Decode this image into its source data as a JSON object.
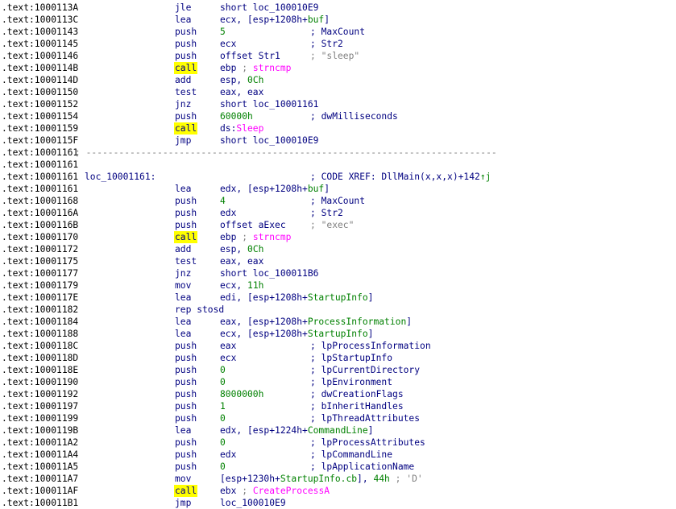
{
  "lines": [
    {
      "addr": ".text:1000113A",
      "mn": "jle",
      "ops": [
        [
          "short loc_100010E9",
          "kw"
        ]
      ]
    },
    {
      "addr": ".text:1000113C",
      "mn": "lea",
      "ops": [
        [
          "ecx, [esp+1208h+",
          "kw"
        ],
        [
          "buf",
          "var"
        ],
        [
          "]",
          "kw"
        ]
      ]
    },
    {
      "addr": ".text:10001143",
      "mn": "push",
      "ops": [
        [
          "5",
          "num"
        ]
      ],
      "cmt": [
        [
          "; MaxCount",
          "cmt"
        ]
      ]
    },
    {
      "addr": ".text:10001145",
      "mn": "push",
      "ops": [
        [
          "ecx",
          "kw"
        ]
      ],
      "cmt": [
        [
          "; Str2",
          "cmt"
        ]
      ]
    },
    {
      "addr": ".text:10001146",
      "mn": "push",
      "ops": [
        [
          "offset Str1",
          "kw"
        ]
      ],
      "cmt": [
        [
          "; \"sleep\"",
          "str"
        ]
      ]
    },
    {
      "addr": ".text:1000114B",
      "mn": "call",
      "hl": true,
      "ops": [
        [
          "ebp ",
          "kw"
        ],
        [
          "; ",
          "str"
        ],
        [
          "strncmp",
          "sym"
        ]
      ]
    },
    {
      "addr": ".text:1000114D",
      "mn": "add",
      "ops": [
        [
          "esp, ",
          "kw"
        ],
        [
          "0Ch",
          "num"
        ]
      ]
    },
    {
      "addr": ".text:10001150",
      "mn": "test",
      "ops": [
        [
          "eax, eax",
          "kw"
        ]
      ]
    },
    {
      "addr": ".text:10001152",
      "mn": "jnz",
      "ops": [
        [
          "short loc_10001161",
          "kw"
        ]
      ]
    },
    {
      "addr": ".text:10001154",
      "mn": "push",
      "ops": [
        [
          "60000h",
          "num"
        ]
      ],
      "cmt": [
        [
          "; dwMilliseconds",
          "cmt"
        ]
      ]
    },
    {
      "addr": ".text:10001159",
      "mn": "call",
      "hl": true,
      "ops": [
        [
          "ds:",
          "kw"
        ],
        [
          "Sleep",
          "sym"
        ]
      ]
    },
    {
      "addr": ".text:1000115F",
      "mn": "jmp",
      "ops": [
        [
          "short loc_100010E9",
          "kw"
        ]
      ]
    },
    {
      "addr": ".text:10001161",
      "sep": "; ---------------------------------------------------------------------------"
    },
    {
      "addr": ".text:10001161"
    },
    {
      "addr": ".text:10001161",
      "label": "loc_10001161:",
      "cmt": [
        [
          "; CODE XREF: DllMain(x,x,x)+142",
          "cmt"
        ],
        [
          "↑j",
          "arrow"
        ]
      ]
    },
    {
      "addr": ".text:10001161",
      "mn": "lea",
      "ops": [
        [
          "edx, [esp+1208h+",
          "kw"
        ],
        [
          "buf",
          "var"
        ],
        [
          "]",
          "kw"
        ]
      ]
    },
    {
      "addr": ".text:10001168",
      "mn": "push",
      "ops": [
        [
          "4",
          "num"
        ]
      ],
      "cmt": [
        [
          "; MaxCount",
          "cmt"
        ]
      ]
    },
    {
      "addr": ".text:1000116A",
      "mn": "push",
      "ops": [
        [
          "edx",
          "kw"
        ]
      ],
      "cmt": [
        [
          "; Str2",
          "cmt"
        ]
      ]
    },
    {
      "addr": ".text:1000116B",
      "mn": "push",
      "ops": [
        [
          "offset aExec",
          "kw"
        ]
      ],
      "cmt": [
        [
          "; \"exec\"",
          "str"
        ]
      ]
    },
    {
      "addr": ".text:10001170",
      "mn": "call",
      "hl": true,
      "ops": [
        [
          "ebp ",
          "kw"
        ],
        [
          "; ",
          "str"
        ],
        [
          "strncmp",
          "sym"
        ]
      ]
    },
    {
      "addr": ".text:10001172",
      "mn": "add",
      "ops": [
        [
          "esp, ",
          "kw"
        ],
        [
          "0Ch",
          "num"
        ]
      ]
    },
    {
      "addr": ".text:10001175",
      "mn": "test",
      "ops": [
        [
          "eax, eax",
          "kw"
        ]
      ]
    },
    {
      "addr": ".text:10001177",
      "mn": "jnz",
      "ops": [
        [
          "short loc_100011B6",
          "kw"
        ]
      ]
    },
    {
      "addr": ".text:10001179",
      "mn": "mov",
      "ops": [
        [
          "ecx, ",
          "kw"
        ],
        [
          "11h",
          "num"
        ]
      ]
    },
    {
      "addr": ".text:1000117E",
      "mn": "lea",
      "ops": [
        [
          "edi, [esp+1208h+",
          "kw"
        ],
        [
          "StartupInfo",
          "var"
        ],
        [
          "]",
          "kw"
        ]
      ]
    },
    {
      "addr": ".text:10001182",
      "mn": "rep stosd"
    },
    {
      "addr": ".text:10001184",
      "mn": "lea",
      "ops": [
        [
          "eax, [esp+1208h+",
          "kw"
        ],
        [
          "ProcessInformation",
          "var"
        ],
        [
          "]",
          "kw"
        ]
      ]
    },
    {
      "addr": ".text:10001188",
      "mn": "lea",
      "ops": [
        [
          "ecx, [esp+1208h+",
          "kw"
        ],
        [
          "StartupInfo",
          "var"
        ],
        [
          "]",
          "kw"
        ]
      ]
    },
    {
      "addr": ".text:1000118C",
      "mn": "push",
      "ops": [
        [
          "eax",
          "kw"
        ]
      ],
      "cmt": [
        [
          "; lpProcessInformation",
          "cmt"
        ]
      ]
    },
    {
      "addr": ".text:1000118D",
      "mn": "push",
      "ops": [
        [
          "ecx",
          "kw"
        ]
      ],
      "cmt": [
        [
          "; lpStartupInfo",
          "cmt"
        ]
      ]
    },
    {
      "addr": ".text:1000118E",
      "mn": "push",
      "ops": [
        [
          "0",
          "num"
        ]
      ],
      "cmt": [
        [
          "; lpCurrentDirectory",
          "cmt"
        ]
      ]
    },
    {
      "addr": ".text:10001190",
      "mn": "push",
      "ops": [
        [
          "0",
          "num"
        ]
      ],
      "cmt": [
        [
          "; lpEnvironment",
          "cmt"
        ]
      ]
    },
    {
      "addr": ".text:10001192",
      "mn": "push",
      "ops": [
        [
          "8000000h",
          "num"
        ]
      ],
      "cmt": [
        [
          "; dwCreationFlags",
          "cmt"
        ]
      ]
    },
    {
      "addr": ".text:10001197",
      "mn": "push",
      "ops": [
        [
          "1",
          "num"
        ]
      ],
      "cmt": [
        [
          "; bInheritHandles",
          "cmt"
        ]
      ]
    },
    {
      "addr": ".text:10001199",
      "mn": "push",
      "ops": [
        [
          "0",
          "num"
        ]
      ],
      "cmt": [
        [
          "; lpThreadAttributes",
          "cmt"
        ]
      ]
    },
    {
      "addr": ".text:1000119B",
      "mn": "lea",
      "ops": [
        [
          "edx, [esp+1224h+",
          "kw"
        ],
        [
          "CommandLine",
          "var"
        ],
        [
          "]",
          "kw"
        ]
      ]
    },
    {
      "addr": ".text:100011A2",
      "mn": "push",
      "ops": [
        [
          "0",
          "num"
        ]
      ],
      "cmt": [
        [
          "; lpProcessAttributes",
          "cmt"
        ]
      ]
    },
    {
      "addr": ".text:100011A4",
      "mn": "push",
      "ops": [
        [
          "edx",
          "kw"
        ]
      ],
      "cmt": [
        [
          "; lpCommandLine",
          "cmt"
        ]
      ]
    },
    {
      "addr": ".text:100011A5",
      "mn": "push",
      "ops": [
        [
          "0",
          "num"
        ]
      ],
      "cmt": [
        [
          "; lpApplicationName",
          "cmt"
        ]
      ]
    },
    {
      "addr": ".text:100011A7",
      "mn": "mov",
      "ops": [
        [
          "[esp+1230h+",
          "kw"
        ],
        [
          "StartupInfo.cb",
          "var"
        ],
        [
          "], ",
          "kw"
        ],
        [
          "44h",
          "num"
        ],
        [
          " ; 'D'",
          "str"
        ]
      ]
    },
    {
      "addr": ".text:100011AF",
      "mn": "call",
      "hl": true,
      "ops": [
        [
          "ebx ",
          "kw"
        ],
        [
          "; ",
          "str"
        ],
        [
          "CreateProcessA",
          "sym"
        ]
      ]
    },
    {
      "addr": ".text:100011B1",
      "mn": "jmp",
      "ops": [
        [
          "loc_100010E9",
          "kw"
        ]
      ]
    }
  ]
}
